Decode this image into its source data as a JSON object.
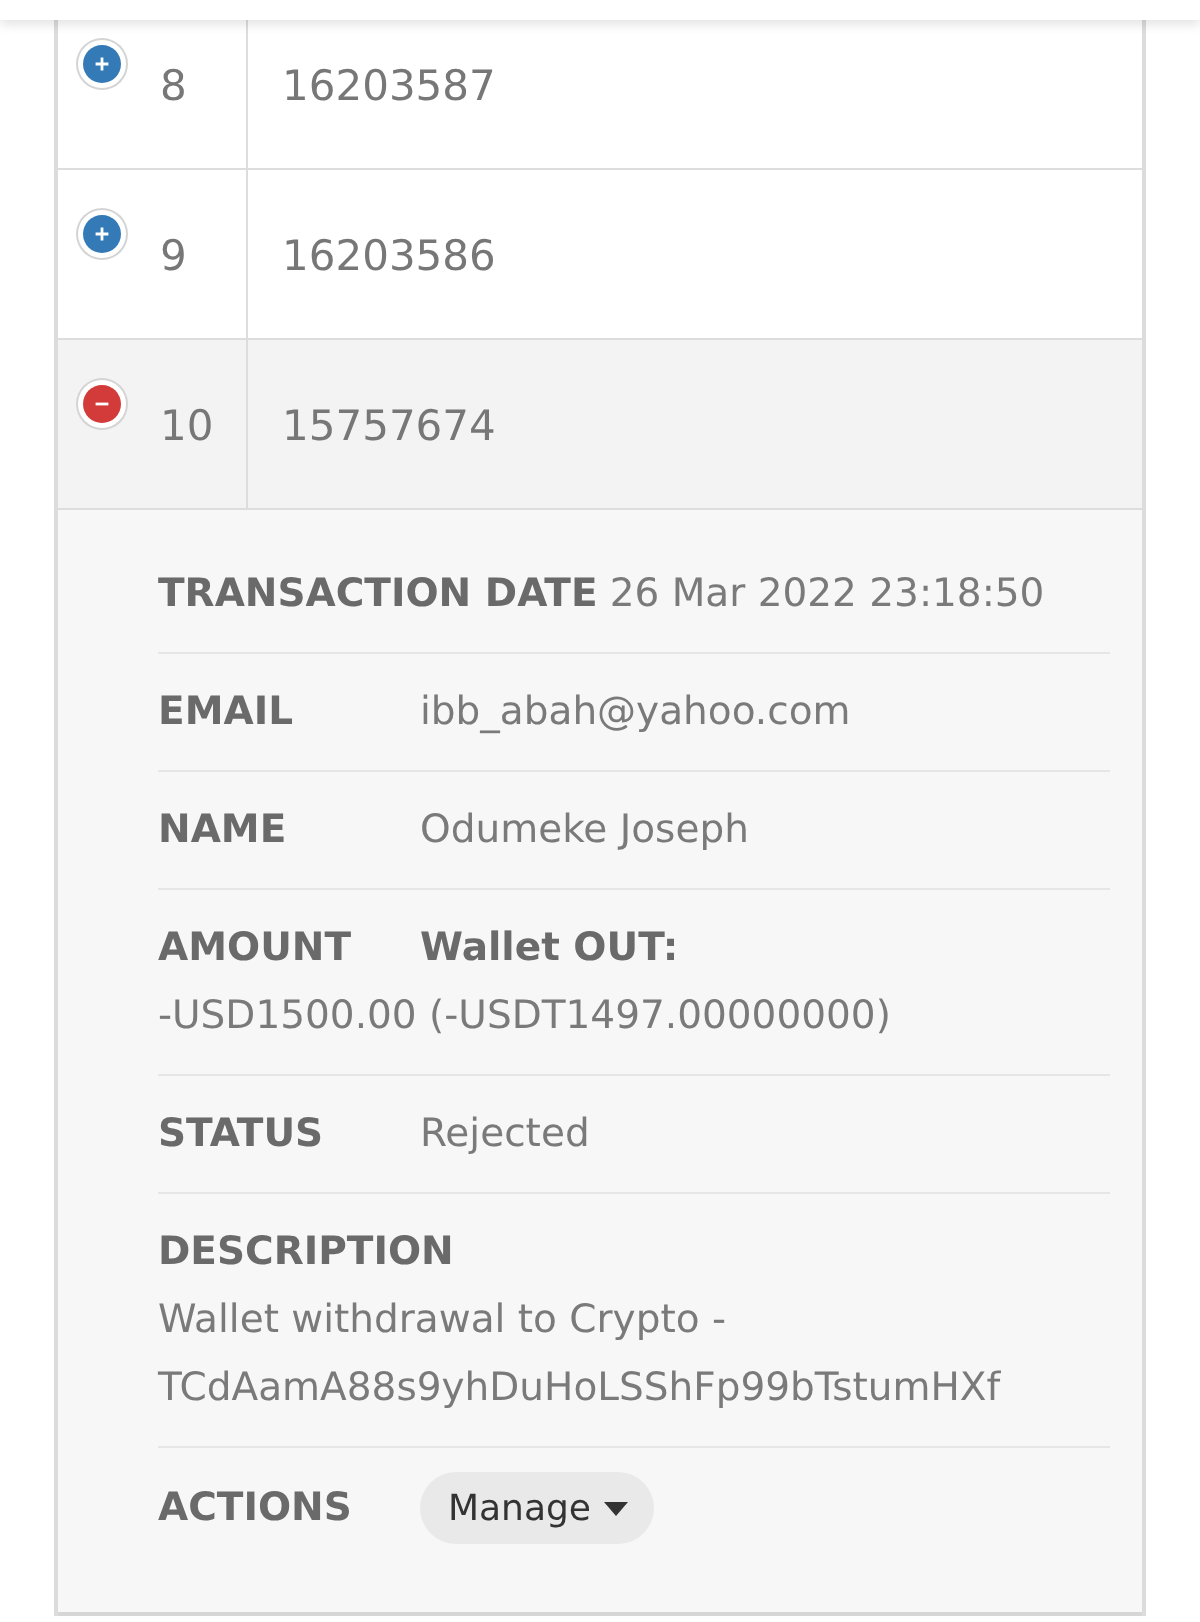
{
  "table": {
    "rows": [
      {
        "number": "8",
        "id": "16203587",
        "expanded": false
      },
      {
        "number": "9",
        "id": "16203586",
        "expanded": false
      },
      {
        "number": "10",
        "id": "15757674",
        "expanded": true,
        "details": [
          {
            "kind": "inline",
            "label": "TRANSACTION DATE",
            "value": "26 Mar 2022 23:18:50"
          },
          {
            "kind": "inline",
            "label": "EMAIL",
            "value": "ibb_abah@yahoo.com"
          },
          {
            "kind": "inline",
            "label": "NAME",
            "value": "Odumeke Joseph"
          },
          {
            "kind": "amount",
            "label": "AMOUNT",
            "type": "Wallet OUT:",
            "value": "-USD1500.00 (-USDT1497.00000000)"
          },
          {
            "kind": "inline",
            "label": "STATUS",
            "value": "Rejected"
          },
          {
            "kind": "stacked",
            "label": "DESCRIPTION",
            "value": "Wallet withdrawal to Crypto - TCdAamA88s9yhDuHoLSShFp99bTstumHXf"
          },
          {
            "kind": "action",
            "label": "ACTIONS",
            "button": "Manage"
          }
        ]
      }
    ]
  }
}
